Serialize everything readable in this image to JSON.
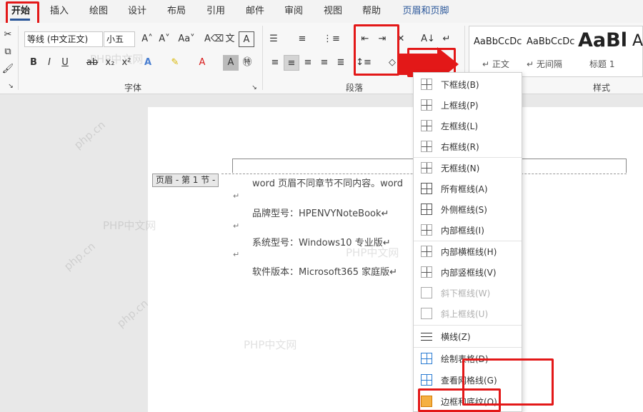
{
  "tabs": [
    "开始",
    "插入",
    "绘图",
    "设计",
    "布局",
    "引用",
    "邮件",
    "审阅",
    "视图",
    "帮助",
    "页眉和页脚"
  ],
  "font": {
    "name": "等线 (中文正文)",
    "size": "小五",
    "group_label": "字体"
  },
  "paragraph": {
    "group_label": "段落"
  },
  "styles": {
    "group_label": "样式",
    "items": [
      {
        "sample": "AaBbCcDc",
        "name": "↵ 正文"
      },
      {
        "sample": "AaBbCcDc",
        "name": "↵ 无间隔"
      },
      {
        "sample": "AaBl",
        "name": "标题 1"
      },
      {
        "sample": "A",
        "name": ""
      }
    ]
  },
  "document": {
    "section_label": "页眉 - 第 1 节 -",
    "lines": [
      "word 页眉不同章节不同内容。word",
      "品牌型号：HPENVYNoteBook↵",
      "系统型号：Windows10 专业版↵",
      "软件版本：Microsoft365 家庭版↵"
    ],
    "para_mark": "↵"
  },
  "border_menu": {
    "items": [
      {
        "label": "下框线(B)",
        "icon": "bottom-border-icon",
        "enabled": true
      },
      {
        "label": "上框线(P)",
        "icon": "top-border-icon",
        "enabled": true
      },
      {
        "label": "左框线(L)",
        "icon": "left-border-icon",
        "enabled": true
      },
      {
        "label": "右框线(R)",
        "icon": "right-border-icon",
        "enabled": true
      },
      {
        "label": "无框线(N)",
        "icon": "no-border-icon",
        "enabled": true
      },
      {
        "label": "所有框线(A)",
        "icon": "all-borders-icon",
        "enabled": true
      },
      {
        "label": "外侧框线(S)",
        "icon": "outside-borders-icon",
        "enabled": true
      },
      {
        "label": "内部框线(I)",
        "icon": "inside-borders-icon",
        "enabled": true
      },
      {
        "label": "内部横框线(H)",
        "icon": "inside-horizontal-border-icon",
        "enabled": true
      },
      {
        "label": "内部竖框线(V)",
        "icon": "inside-vertical-border-icon",
        "enabled": true
      },
      {
        "label": "斜下框线(W)",
        "icon": "diagonal-down-border-icon",
        "enabled": false
      },
      {
        "label": "斜上框线(U)",
        "icon": "diagonal-up-border-icon",
        "enabled": false
      },
      {
        "label": "横线(Z)",
        "icon": "horizontal-line-icon",
        "enabled": true
      },
      {
        "label": "绘制表格(D)",
        "icon": "draw-table-icon",
        "enabled": true
      },
      {
        "label": "查看网格线(G)",
        "icon": "view-gridlines-icon",
        "enabled": true
      },
      {
        "label": "边框和底纹(O)...",
        "icon": "borders-shading-icon",
        "enabled": true
      }
    ]
  },
  "watermark": "PHP中文网",
  "watermark_rot": "php.cn",
  "accent_color": "#2b579a",
  "highlight_color": "#e31818"
}
